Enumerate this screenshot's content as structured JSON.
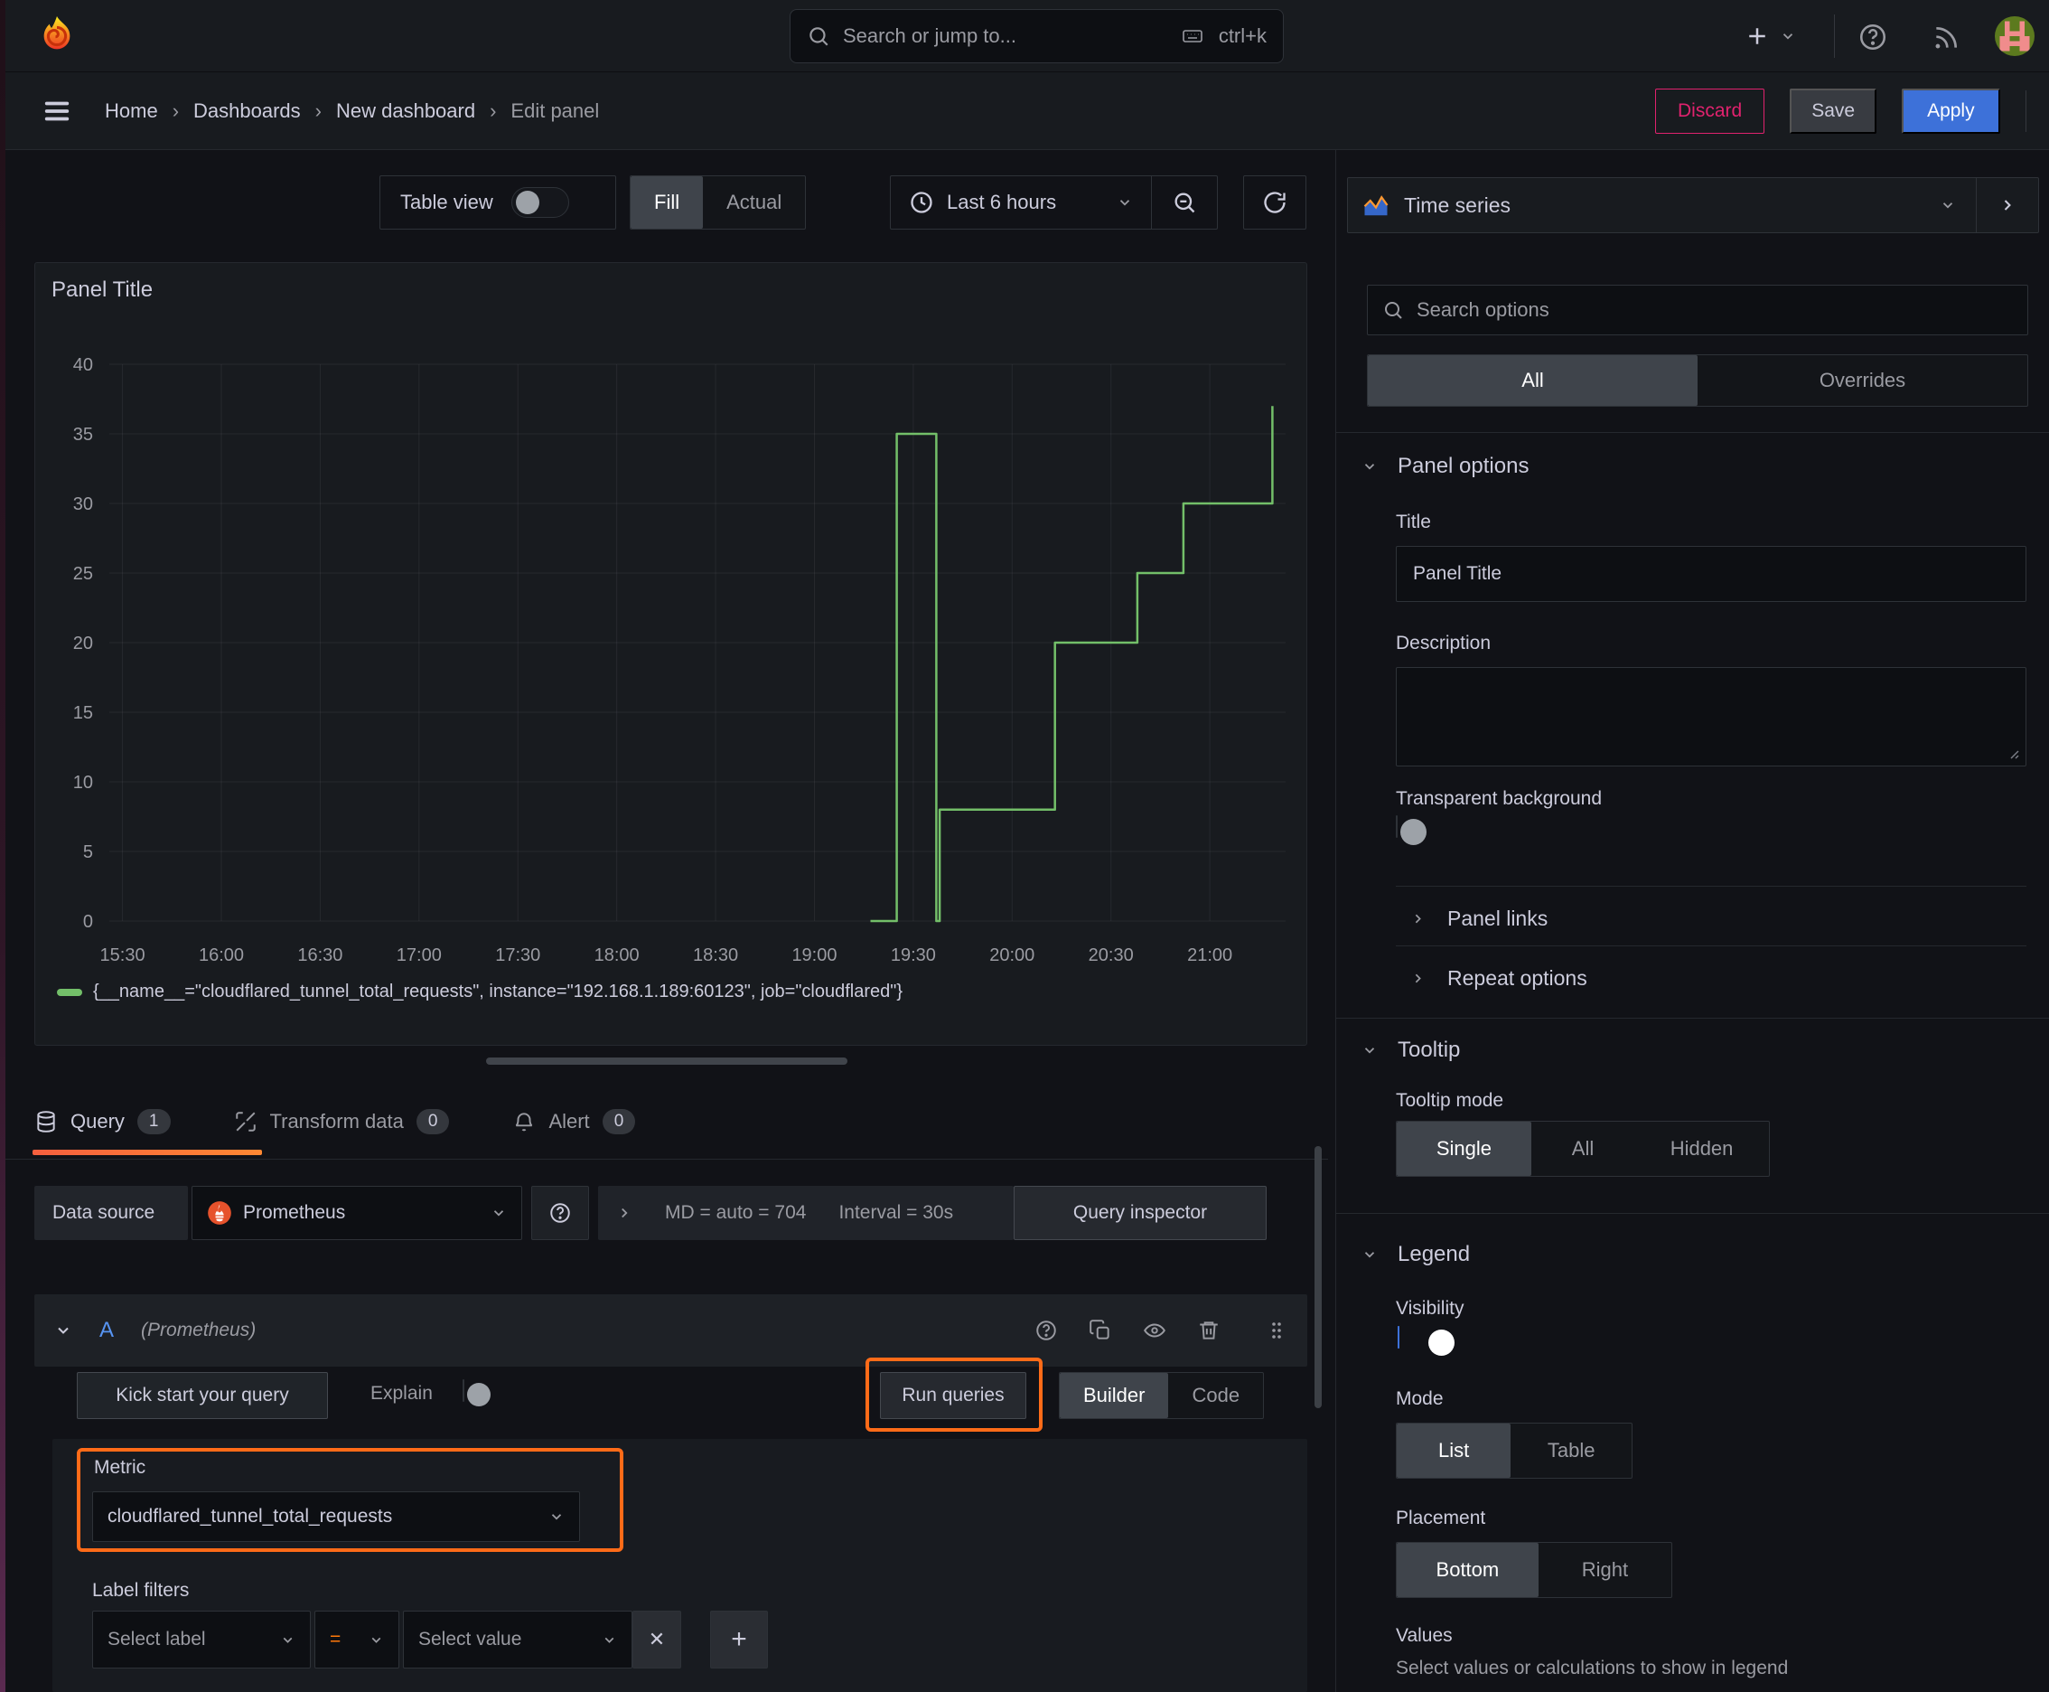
{
  "topnav": {
    "search_placeholder": "Search or jump to...",
    "search_shortcut": "ctrl+k"
  },
  "breadcrumb": {
    "items": [
      "Home",
      "Dashboards",
      "New dashboard",
      "Edit panel"
    ],
    "separator": "›"
  },
  "header_actions": {
    "discard": "Discard",
    "save": "Save",
    "apply": "Apply"
  },
  "toolbar": {
    "table_view": "Table view",
    "fill": "Fill",
    "actual": "Actual",
    "time_range": "Last 6 hours"
  },
  "panel": {
    "title": "Panel Title",
    "legend": "{__name__=\"cloudflared_tunnel_total_requests\", instance=\"192.168.1.189:60123\", job=\"cloudflared\"}"
  },
  "chart_data": {
    "type": "line",
    "title": "Panel Title",
    "x_ticks": [
      "15:30",
      "16:00",
      "16:30",
      "17:00",
      "17:30",
      "18:00",
      "18:30",
      "19:00",
      "19:30",
      "20:00",
      "20:30",
      "21:00"
    ],
    "x_range": [
      "15:26",
      "21:23"
    ],
    "y_ticks": [
      0,
      5,
      10,
      15,
      20,
      25,
      30,
      35,
      40
    ],
    "ylim": [
      0,
      40
    ],
    "grid": true,
    "legend_position": "bottom",
    "series": [
      {
        "name": "{__name__=\"cloudflared_tunnel_total_requests\", instance=\"192.168.1.189:60123\", job=\"cloudflared\"}",
        "color": "#73bf69",
        "interpolation": "step-after",
        "steps": [
          [
            "19:17",
            0
          ],
          [
            "19:25",
            35
          ],
          [
            "19:37",
            0
          ],
          [
            "19:38",
            8
          ],
          [
            "20:13",
            20
          ],
          [
            "20:38",
            25
          ],
          [
            "20:52",
            30
          ],
          [
            "21:19",
            37
          ]
        ]
      }
    ]
  },
  "tabs": {
    "query": "Query",
    "query_count": "1",
    "transform": "Transform data",
    "transform_count": "0",
    "alert": "Alert",
    "alert_count": "0"
  },
  "datasource_row": {
    "label": "Data source",
    "datasource": "Prometheus",
    "stats_md": "MD = auto = 704",
    "stats_interval": "Interval = 30s",
    "inspector": "Query inspector"
  },
  "query_editor": {
    "ref_id": "A",
    "ds_hint": "(Prometheus)",
    "kick_start": "Kick start your query",
    "explain": "Explain",
    "run_queries": "Run queries",
    "builder": "Builder",
    "code": "Code",
    "metric_label": "Metric",
    "metric_value": "cloudflared_tunnel_total_requests",
    "label_filters": "Label filters",
    "select_label": "Select label",
    "operator": "=",
    "select_value": "Select value",
    "remove": "✕",
    "add": "+"
  },
  "options_panel": {
    "viz_name": "Time series",
    "search_placeholder": "Search options",
    "tab_all": "All",
    "tab_overrides": "Overrides",
    "panel_options": "Panel options",
    "title_label": "Title",
    "title_value": "Panel Title",
    "description_label": "Description",
    "transparent_bg": "Transparent background",
    "panel_links": "Panel links",
    "repeat_options": "Repeat options",
    "tooltip": "Tooltip",
    "tooltip_mode": "Tooltip mode",
    "tooltip_modes": [
      "Single",
      "All",
      "Hidden"
    ],
    "legend": "Legend",
    "visibility": "Visibility",
    "mode": "Mode",
    "legend_modes": [
      "List",
      "Table"
    ],
    "placement": "Placement",
    "placements": [
      "Bottom",
      "Right"
    ],
    "values_label": "Values",
    "values_hint": "Select values or calculations to show in legend"
  },
  "colors": {
    "background": "#111217",
    "surface": "#181b1f",
    "surface_header": "#1e2126",
    "subpanel": "#181b20",
    "input_bg": "#0d0f13",
    "border": "#2e3238",
    "border_strong": "#44484f",
    "text": "#ccccdc",
    "text_dim": "#9a9ba2",
    "blue": "#3d71d9",
    "ref_id_blue": "#5794f2",
    "orange": "#ff780a",
    "tab_underline_from": "#f55f3e",
    "tab_underline_to": "#ff8833",
    "pink": "#e0226e",
    "green": "#73bf69",
    "selected_segment": "#3f444b",
    "annotation": "#ff6b18",
    "toggle_off_knob": "#9da2a8"
  }
}
